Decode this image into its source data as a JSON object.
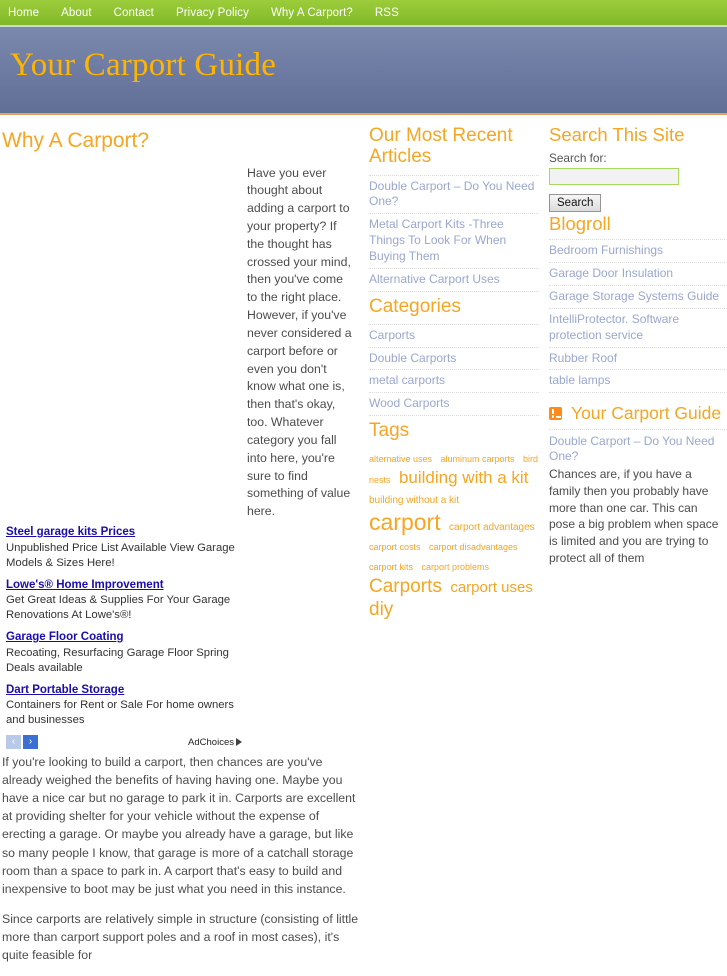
{
  "nav": {
    "items": [
      {
        "label": "Home"
      },
      {
        "label": "About"
      },
      {
        "label": "Contact"
      },
      {
        "label": "Privacy Policy"
      },
      {
        "label": "Why A Carport?"
      },
      {
        "label": "RSS"
      }
    ]
  },
  "header": {
    "site_title": "Your Carport Guide",
    "title_color": "#ffb400",
    "banner_color_top": "#7b89ae",
    "banner_color_bottom": "#616f97",
    "nav_color": "#8fc332"
  },
  "main": {
    "page_title": "Why A Carport?",
    "ads": {
      "items": [
        {
          "title": "Steel garage kits Prices",
          "desc": "Unpublished Price List Available View Garage Models & Sizes Here!"
        },
        {
          "title": "Lowe's® Home Improvement",
          "desc": "Get Great Ideas & Supplies For Your Garage Renovations At Lowe's®!"
        },
        {
          "title": "Garage Floor Coating",
          "desc": "Recoating, Resurfacing Garage Floor Spring Deals available"
        },
        {
          "title": "Dart Portable Storage",
          "desc": "Containers for Rent or Sale For home owners and businesses"
        }
      ],
      "prev_arrow": "‹",
      "next_arrow": "›",
      "adchoices_label": "AdChoices"
    },
    "intro_paragraph": "Have you ever thought about adding a carport to your property? If the thought has crossed your mind, then you've come to the right place. However, if you've never considered a carport before or even you don't know what one is, then that's okay, too. Whatever category you fall into here, you're sure to find something of value here.",
    "paragraphs": [
      "If you're looking to build a carport, then chances are you've already weighed the benefits of having having one. Maybe you have a nice car but no garage to park it in. Carports are excellent at providing shelter for your vehicle without the expense of erecting a garage. Or maybe you already have a garage, but like so many people I know, that garage is more of a catchall storage room than a space to park in. A carport that's easy to build and inexpensive to boot may be just what you need in this instance.",
      "Since carports are relatively simple in structure (consisting of little more than carport support poles and a roof in most cases), it's quite feasible for"
    ]
  },
  "mid_sidebar": {
    "recent_heading": "Our Most Recent Articles",
    "recent_items": [
      "Double Carport – Do You Need One?",
      "Metal Carport Kits -Three Things To Look For When Buying Them",
      "Alternative Carport Uses"
    ],
    "categories_heading": "Categories",
    "categories": [
      "Carports",
      "Double Carports",
      "metal carports",
      "Wood Carports"
    ],
    "tags_heading": "Tags",
    "tags": [
      {
        "label": "alternative uses",
        "size": 9
      },
      {
        "label": "aluminum carports",
        "size": 9
      },
      {
        "label": "bird nests",
        "size": 9
      },
      {
        "label": "building with a kit",
        "size": 17
      },
      {
        "label": "building without a kit",
        "size": 10
      },
      {
        "label": "carport",
        "size": 23
      },
      {
        "label": "carport advantages",
        "size": 10
      },
      {
        "label": "carport costs",
        "size": 9
      },
      {
        "label": "carport disadvantages",
        "size": 9
      },
      {
        "label": "carport kits",
        "size": 9
      },
      {
        "label": "carport problems",
        "size": 9
      },
      {
        "label": "Carports",
        "size": 19
      },
      {
        "label": "carport uses",
        "size": 15
      },
      {
        "label": "diy",
        "size": 19
      }
    ]
  },
  "right_sidebar": {
    "search_heading": "Search This Site",
    "search_label": "Search for:",
    "search_value": "",
    "search_placeholder": "",
    "search_button": "Search",
    "blogroll_heading": "Blogroll",
    "blogroll_items": [
      "Bedroom Furnishings",
      "Garage Door Insulation",
      "Garage Storage Systems Guide",
      "IntelliProtector. Software protection service",
      "Rubber Roof",
      "table lamps"
    ],
    "rss_heading": "Your Carport Guide",
    "rss_entry_title": "Double Carport – Do You Need One?",
    "rss_entry_body": "Chances are, if you have a family then you probably have more than one car. This can pose a big problem when space is limited and you are trying to protect all of them"
  }
}
